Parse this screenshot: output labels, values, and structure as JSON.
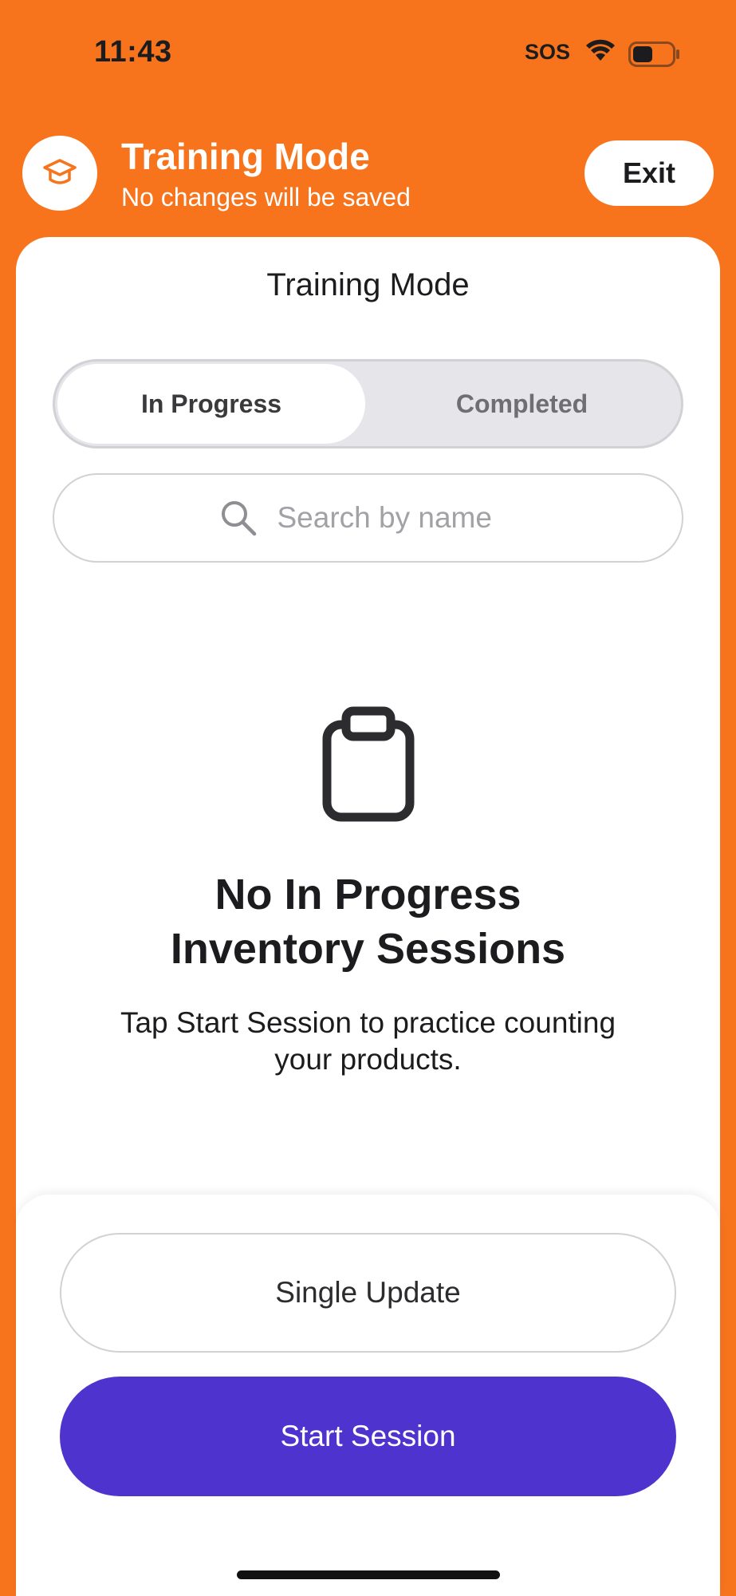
{
  "status_bar": {
    "time": "11:43",
    "sos": "SOS"
  },
  "header": {
    "title": "Training Mode",
    "subtitle": "No changes will be saved",
    "exit_label": "Exit"
  },
  "sheet": {
    "title": "Training Mode"
  },
  "tabs": [
    {
      "label": "In Progress",
      "selected": true
    },
    {
      "label": "Completed",
      "selected": false
    }
  ],
  "search": {
    "placeholder": "Search by name",
    "value": ""
  },
  "empty_state": {
    "title_line1": "No In Progress",
    "title_line2": "Inventory Sessions",
    "desc_line1": "Tap Start Session to practice counting",
    "desc_line2": "your products."
  },
  "actions": {
    "single_update_label": "Single Update",
    "start_session_label": "Start Session"
  },
  "icons": {
    "header": "graduation-cap-icon",
    "search": "search-icon",
    "empty": "clipboard-icon"
  },
  "colors": {
    "accent": "#F7741C",
    "primary_button": "#4F33CF"
  }
}
